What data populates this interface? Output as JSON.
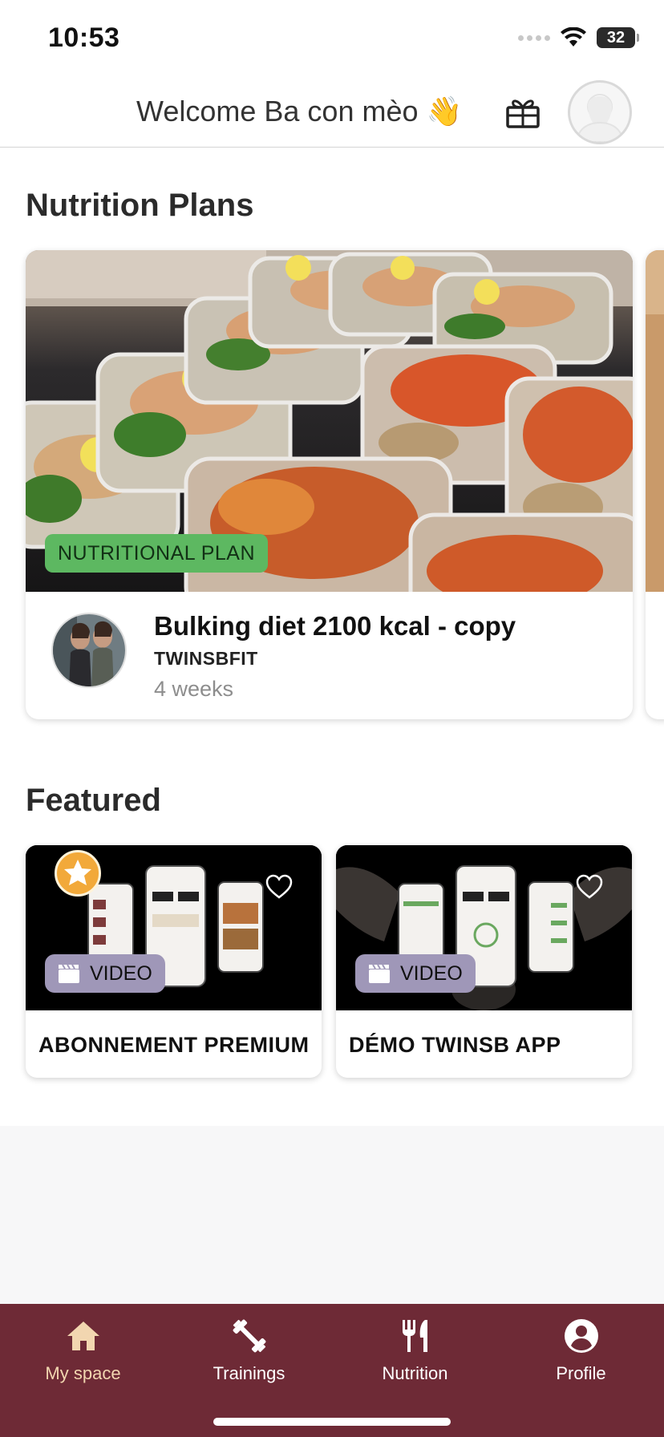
{
  "status_bar": {
    "time": "10:53",
    "battery": "32"
  },
  "header": {
    "welcome_text": "Welcome Ba con mèo 👋",
    "gift_icon": "gift-icon",
    "avatar_icon": "user-avatar-icon"
  },
  "nutrition": {
    "section_title": "Nutrition Plans",
    "card": {
      "badge": "NUTRITIONAL PLAN",
      "title": "Bulking diet 2100 kcal - copy",
      "author": "TWINSBFIT",
      "duration": "4 weeks"
    }
  },
  "featured": {
    "section_title": "Featured",
    "items": [
      {
        "title": "ABONNEMENT PREMIUM",
        "badge": "VIDEO",
        "starred": true
      },
      {
        "title": "DÉMO TWINSB APP",
        "badge": "VIDEO",
        "starred": false
      }
    ]
  },
  "bottom_nav": {
    "items": [
      {
        "label": "My space",
        "icon": "home-icon",
        "active": true
      },
      {
        "label": "Trainings",
        "icon": "dumbbell-icon",
        "active": false
      },
      {
        "label": "Nutrition",
        "icon": "fork-knife-icon",
        "active": false
      },
      {
        "label": "Profile",
        "icon": "profile-icon",
        "active": false
      }
    ]
  },
  "colors": {
    "nav_background": "#6e2a36",
    "nav_active": "#f2d6b0",
    "nutrition_badge": "#5db861",
    "video_badge": "#9f97b8",
    "star_badge": "#f2a93a"
  }
}
